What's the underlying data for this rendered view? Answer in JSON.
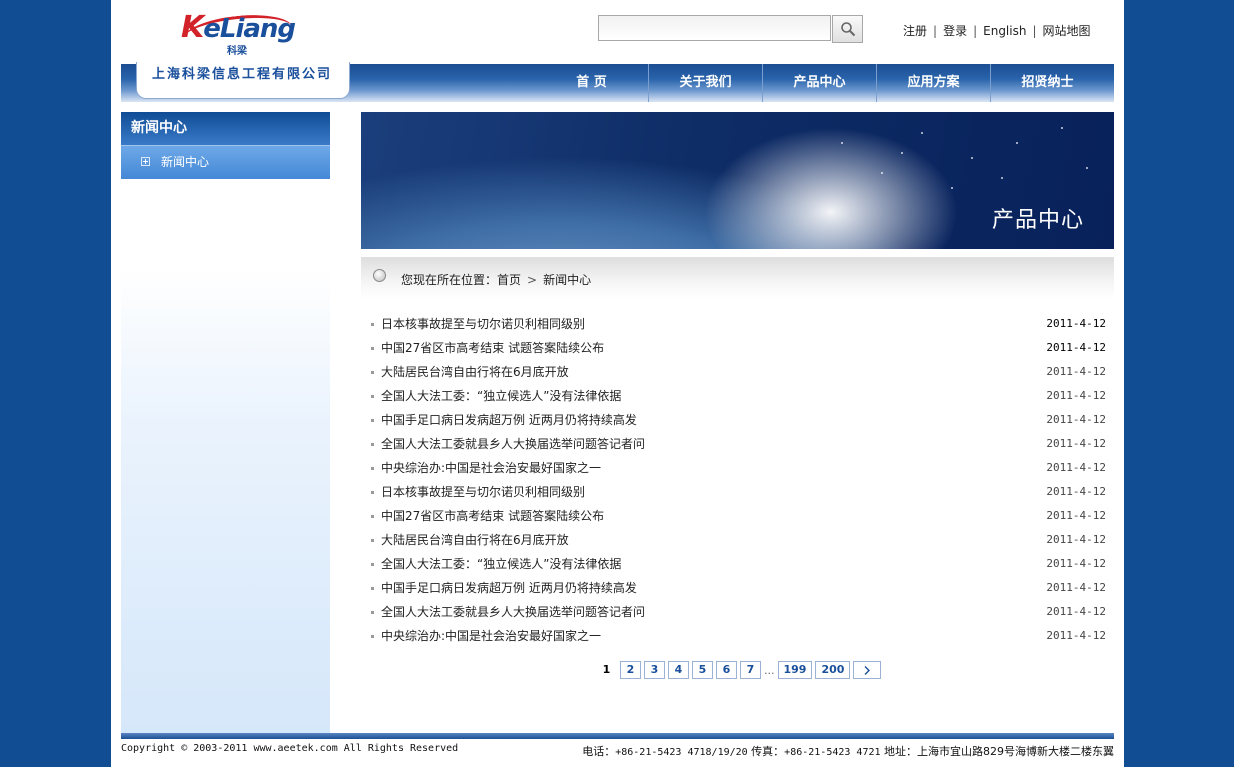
{
  "header": {
    "logo_brand_k": "K",
    "logo_brand_rest": "eLiang",
    "logo_sub": "科梁",
    "company_name": "上海科梁信息工程有限公司",
    "search": {
      "value": "",
      "placeholder": ""
    },
    "top_links": [
      "注册",
      "登录",
      "English",
      "网站地图"
    ]
  },
  "nav": {
    "items": [
      "首 页",
      "关于我们",
      "产品中心",
      "应用方案",
      "招贤纳士"
    ]
  },
  "sidebar": {
    "title": "新闻中心",
    "items": [
      "新闻中心"
    ]
  },
  "banner": {
    "title": "产品中心"
  },
  "breadcrumb": {
    "prefix": "您现在所在位置：",
    "home": "首页",
    "arrow": ">",
    "current": "新闻中心"
  },
  "news": [
    {
      "title": "日本核事故提至与切尔诺贝利相同级别",
      "date": "2011-4-12"
    },
    {
      "title": "中国27省区市高考结束 试题答案陆续公布",
      "date": "2011-4-12"
    },
    {
      "title": "大陆居民台湾自由行将在6月底开放",
      "date": "2011-4-12"
    },
    {
      "title": "全国人大法工委：“独立候选人”没有法律依据",
      "date": "2011-4-12"
    },
    {
      "title": "中国手足口病日发病超万例 近两月仍将持续高发",
      "date": "2011-4-12"
    },
    {
      "title": "全国人大法工委就县乡人大换届选举问题答记者问",
      "date": "2011-4-12"
    },
    {
      "title": "中央综治办:中国是社会治安最好国家之一",
      "date": "2011-4-12"
    },
    {
      "title": "日本核事故提至与切尔诺贝利相同级别",
      "date": "2011-4-12"
    },
    {
      "title": "中国27省区市高考结束 试题答案陆续公布",
      "date": "2011-4-12"
    },
    {
      "title": "大陆居民台湾自由行将在6月底开放",
      "date": "2011-4-12"
    },
    {
      "title": "全国人大法工委：“独立候选人”没有法律依据",
      "date": "2011-4-12"
    },
    {
      "title": "中国手足口病日发病超万例 近两月仍将持续高发",
      "date": "2011-4-12"
    },
    {
      "title": "全国人大法工委就县乡人大换届选举问题答记者问",
      "date": "2011-4-12"
    },
    {
      "title": "中央综治办:中国是社会治安最好国家之一",
      "date": "2011-4-12"
    }
  ],
  "pager": {
    "current": "1",
    "pages": [
      "2",
      "3",
      "4",
      "5",
      "6",
      "7"
    ],
    "dots": "...",
    "tail": [
      "199",
      "200"
    ]
  },
  "footer": {
    "copyright": "Copyright © 2003-2011 www.aeetek.com All Rights Reserved",
    "tel_label": "电话：",
    "tel": "+86-21-5423 4718/19/20",
    "fax_label": "传真：",
    "fax": "+86-21-5423 4721",
    "addr_label": "地址：",
    "addr": "上海市宜山路829号海博新大楼二楼东翼"
  },
  "colors": {
    "page_bg": "#104d93",
    "brand_blue": "#1a4f9c",
    "brand_red": "#d3232a"
  }
}
